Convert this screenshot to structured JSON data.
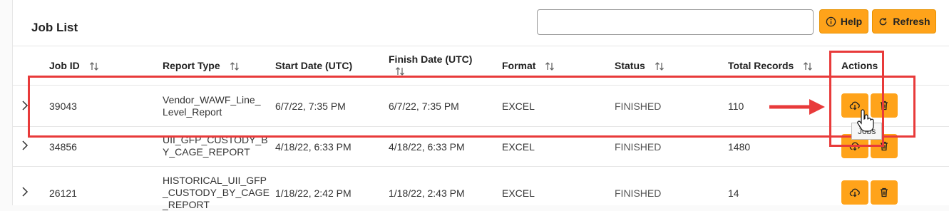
{
  "header": {
    "title": "Job List",
    "search_placeholder": "",
    "help_label": "Help",
    "refresh_label": "Refresh"
  },
  "columns": {
    "job_id": "Job ID",
    "report_type": "Report Type",
    "start_date": "Start Date (UTC)",
    "finish_date": "Finish Date (UTC)",
    "format": "Format",
    "status": "Status",
    "total_records": "Total Records",
    "actions": "Actions"
  },
  "rows": [
    {
      "job_id": "39043",
      "report_type": [
        "Vendor_WAWF_Line_",
        "Level_Report"
      ],
      "start_date": "6/7/22, 7:35 PM",
      "finish_date": "6/7/22, 7:35 PM",
      "format": "EXCEL",
      "status": "FINISHED",
      "total_records": "110"
    },
    {
      "job_id": "34856",
      "report_type": [
        "UII_GFP_CUSTODY_B",
        "Y_CAGE_REPORT"
      ],
      "start_date": "4/18/22, 6:33 PM",
      "finish_date": "4/18/22, 6:33 PM",
      "format": "EXCEL",
      "status": "FINISHED",
      "total_records": "1480"
    },
    {
      "job_id": "26121",
      "report_type": [
        "HISTORICAL_UII_GFP",
        "_CUSTODY_BY_CAGE",
        "_REPORT"
      ],
      "start_date": "1/18/22, 2:42 PM",
      "finish_date": "1/18/22, 2:43 PM",
      "format": "EXCEL",
      "status": "FINISHED",
      "total_records": "14"
    }
  ],
  "tooltip": "Jobs",
  "colors": {
    "accent": "#ffa31a",
    "highlight": "#e83a3a"
  },
  "icons": {
    "download": "cloud-download-icon",
    "delete": "trash-icon",
    "help": "info-icon",
    "refresh": "refresh-icon",
    "sort": "sort-arrows-icon",
    "expand": "chevron-right-icon"
  }
}
